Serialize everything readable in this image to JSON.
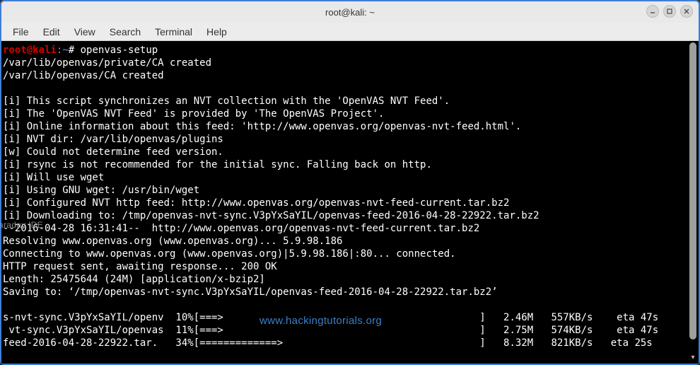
{
  "titlebar": {
    "title": "root@kali: ~"
  },
  "menubar": {
    "items": [
      "File",
      "Edit",
      "View",
      "Search",
      "Terminal",
      "Help"
    ]
  },
  "prompt": {
    "user": "root",
    "at": "@",
    "host": "kali",
    "sep": ":",
    "path": "~",
    "hash": "# "
  },
  "command": "openvas-setup",
  "output_lines": [
    "/var/lib/openvas/private/CA created",
    "/var/lib/openvas/CA created",
    "",
    "[i] This script synchronizes an NVT collection with the 'OpenVAS NVT Feed'.",
    "[i] The 'OpenVAS NVT Feed' is provided by 'The OpenVAS Project'.",
    "[i] Online information about this feed: 'http://www.openvas.org/openvas-nvt-feed.html'.",
    "[i] NVT dir: /var/lib/openvas/plugins",
    "[w] Could not determine feed version.",
    "[i] rsync is not recommended for the initial sync. Falling back on http.",
    "[i] Will use wget",
    "[i] Using GNU wget: /usr/bin/wget",
    "[i] Configured NVT http feed: http://www.openvas.org/openvas-nvt-feed-current.tar.bz2",
    "[i] Downloading to: /tmp/openvas-nvt-sync.V3pYxSaYIL/openvas-feed-2016-04-28-22922.tar.bz2",
    "--2016-04-28 16:31:41--  http://www.openvas.org/openvas-nvt-feed-current.tar.bz2",
    "Resolving www.openvas.org (www.openvas.org)... 5.9.98.186",
    "Connecting to www.openvas.org (www.openvas.org)|5.9.98.186|:80... connected.",
    "HTTP request sent, awaiting response... 200 OK",
    "Length: 25475644 (24M) [application/x-bzip2]",
    "Saving to: ‘/tmp/openvas-nvt-sync.V3pYxSaYIL/openvas-feed-2016-04-28-22922.tar.bz2’",
    "",
    "s-nvt-sync.V3pYxSaYIL/openv  10%[===>                                           ]   2.46M   557KB/s    eta 47s",
    " vt-sync.V3pYxSaYIL/openvas  11%[===>                                           ]   2.75M   574KB/s    eta 47s",
    "feed-2016-04-28-22922.tar.   34%[=============>                                 ]   8.32M   821KB/s   eta 25s"
  ],
  "watermarks": {
    "faraday": "araday IDE",
    "url": "www.hackingtutorials.org"
  }
}
